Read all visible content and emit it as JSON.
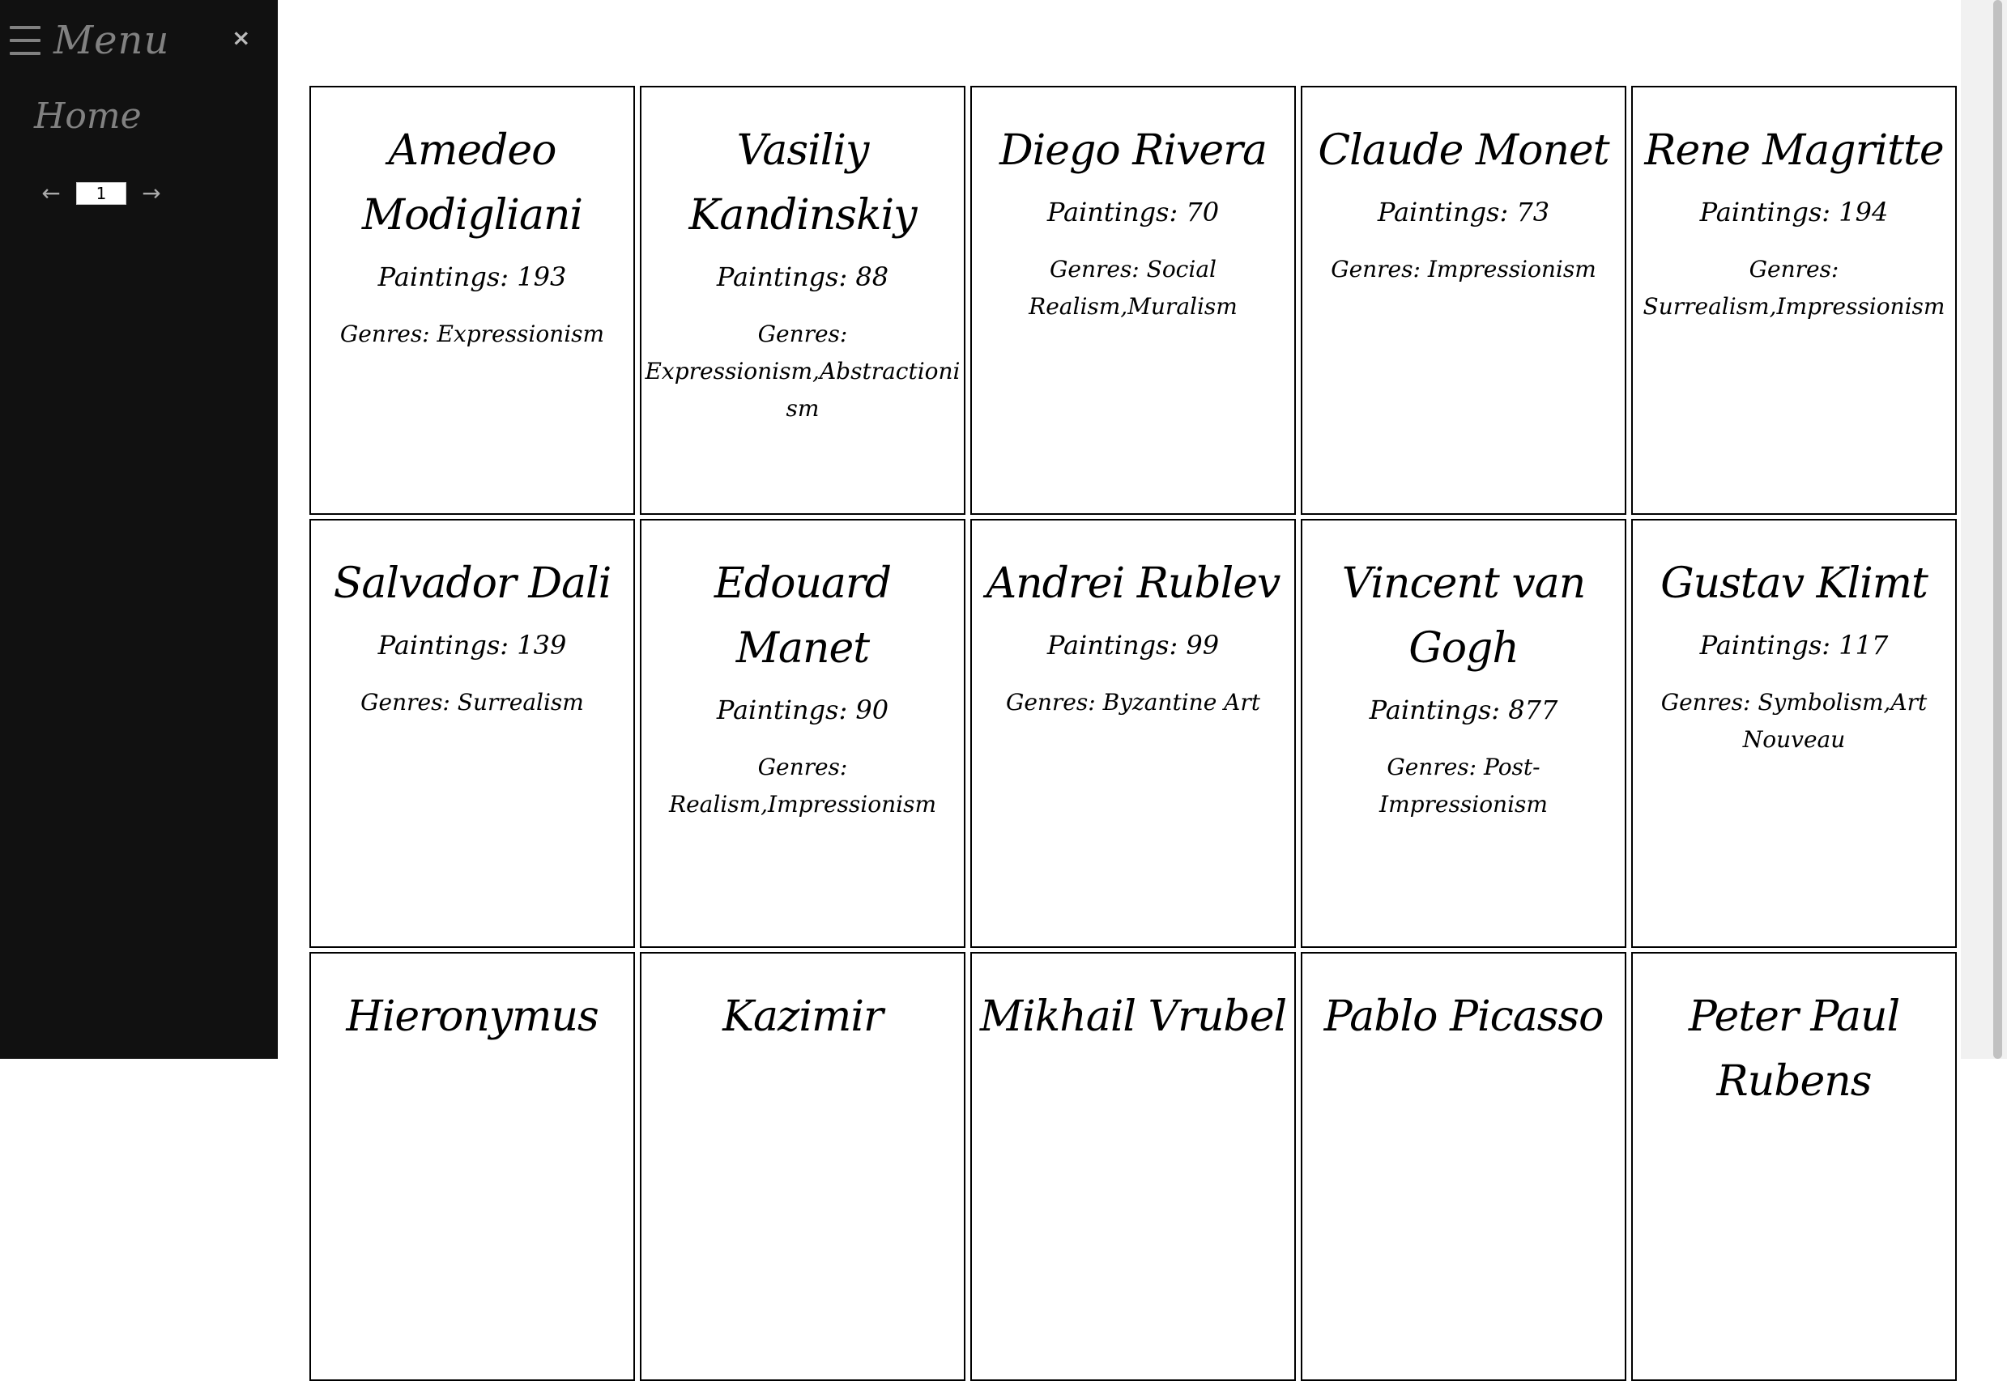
{
  "sidebar": {
    "menu_title": "Menu",
    "close_label": "×",
    "home_label": "Home",
    "pager": {
      "prev_label": "←",
      "next_label": "→",
      "page_value": "1"
    }
  },
  "artists": [
    {
      "name": "Amedeo Modigliani",
      "paintings": "Paintings: 193",
      "genres": "Genres: Expressionism"
    },
    {
      "name": "Vasiliy Kandinskiy",
      "paintings": "Paintings: 88",
      "genres": "Genres: Expressionism,Abstractionism"
    },
    {
      "name": "Diego Rivera",
      "paintings": "Paintings: 70",
      "genres": "Genres: Social Realism,Muralism"
    },
    {
      "name": "Claude Monet",
      "paintings": "Paintings: 73",
      "genres": "Genres: Impressionism"
    },
    {
      "name": "Rene Magritte",
      "paintings": "Paintings: 194",
      "genres": "Genres: Surrealism,Impressionism"
    },
    {
      "name": "Salvador Dali",
      "paintings": "Paintings: 139",
      "genres": "Genres: Surrealism"
    },
    {
      "name": "Edouard Manet",
      "paintings": "Paintings: 90",
      "genres": "Genres: Realism,Impressionism"
    },
    {
      "name": "Andrei Rublev",
      "paintings": "Paintings: 99",
      "genres": "Genres: Byzantine Art"
    },
    {
      "name": "Vincent van Gogh",
      "paintings": "Paintings: 877",
      "genres": "Genres: Post-Impressionism"
    },
    {
      "name": "Gustav Klimt",
      "paintings": "Paintings: 117",
      "genres": "Genres: Symbolism,Art Nouveau"
    },
    {
      "name": "Hieronymus",
      "paintings": "",
      "genres": ""
    },
    {
      "name": "Kazimir",
      "paintings": "",
      "genres": ""
    },
    {
      "name": "Mikhail Vrubel",
      "paintings": "",
      "genres": ""
    },
    {
      "name": "Pablo Picasso",
      "paintings": "",
      "genres": ""
    },
    {
      "name": "Peter Paul Rubens",
      "paintings": "",
      "genres": ""
    }
  ]
}
